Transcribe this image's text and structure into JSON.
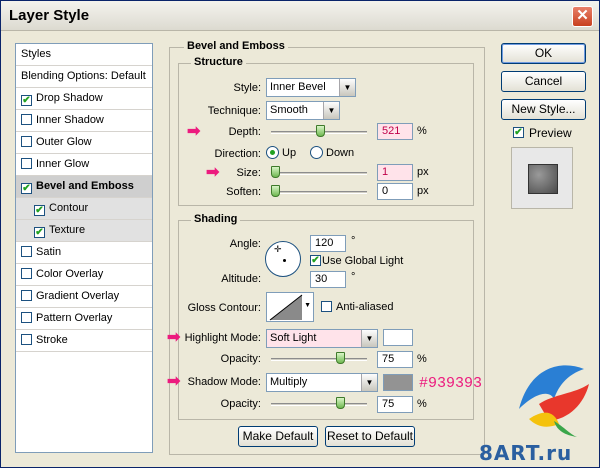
{
  "window": {
    "title": "Layer Style"
  },
  "styles_list": [
    {
      "label": "Styles",
      "checkbox": false,
      "checked": false,
      "selected": false,
      "sub": false
    },
    {
      "label": "Blending Options: Default",
      "checkbox": false,
      "checked": false,
      "selected": false,
      "sub": false
    },
    {
      "label": "Drop Shadow",
      "checkbox": true,
      "checked": true,
      "selected": false,
      "sub": false
    },
    {
      "label": "Inner Shadow",
      "checkbox": true,
      "checked": false,
      "selected": false,
      "sub": false
    },
    {
      "label": "Outer Glow",
      "checkbox": true,
      "checked": false,
      "selected": false,
      "sub": false
    },
    {
      "label": "Inner Glow",
      "checkbox": true,
      "checked": false,
      "selected": false,
      "sub": false
    },
    {
      "label": "Bevel and Emboss",
      "checkbox": true,
      "checked": true,
      "selected": true,
      "sub": false
    },
    {
      "label": "Contour",
      "checkbox": true,
      "checked": true,
      "selected": false,
      "sub": true
    },
    {
      "label": "Texture",
      "checkbox": true,
      "checked": true,
      "selected": false,
      "sub": true
    },
    {
      "label": "Satin",
      "checkbox": true,
      "checked": false,
      "selected": false,
      "sub": false
    },
    {
      "label": "Color Overlay",
      "checkbox": true,
      "checked": false,
      "selected": false,
      "sub": false
    },
    {
      "label": "Gradient Overlay",
      "checkbox": true,
      "checked": false,
      "selected": false,
      "sub": false
    },
    {
      "label": "Pattern Overlay",
      "checkbox": true,
      "checked": false,
      "selected": false,
      "sub": false
    },
    {
      "label": "Stroke",
      "checkbox": true,
      "checked": false,
      "selected": false,
      "sub": false
    }
  ],
  "bevel": {
    "title": "Bevel and Emboss",
    "structure": {
      "title": "Structure",
      "style_label": "Style:",
      "style_value": "Inner Bevel",
      "technique_label": "Technique:",
      "technique_value": "Smooth",
      "depth_label": "Depth:",
      "depth_value": "521",
      "depth_unit": "%",
      "depth_fraction": 0.52,
      "direction_label": "Direction:",
      "direction_up": "Up",
      "direction_down": "Down",
      "size_label": "Size:",
      "size_value": "1",
      "size_unit": "px",
      "size_fraction": 0.0,
      "soften_label": "Soften:",
      "soften_value": "0",
      "soften_unit": "px",
      "soften_fraction": 0.0
    },
    "shading": {
      "title": "Shading",
      "angle_label": "Angle:",
      "angle_value": "120",
      "angle_unit": "°",
      "global_light_label": "Use Global Light",
      "altitude_label": "Altitude:",
      "altitude_value": "30",
      "altitude_unit": "°",
      "gloss_label": "Gloss Contour:",
      "anti_aliased_label": "Anti-aliased",
      "highlight_label": "Highlight Mode:",
      "highlight_value": "Soft Light",
      "highlight_color": "#ffffff",
      "highlight_opacity_label": "Opacity:",
      "highlight_opacity": "75",
      "highlight_opacity_fraction": 0.75,
      "shadow_label": "Shadow Mode:",
      "shadow_value": "Multiply",
      "shadow_color": "#939393",
      "shadow_opacity_label": "Opacity:",
      "shadow_opacity": "75",
      "shadow_opacity_fraction": 0.75,
      "percent": "%"
    },
    "make_default": "Make Default",
    "reset_default": "Reset to Default"
  },
  "buttons": {
    "ok": "OK",
    "cancel": "Cancel",
    "new_style": "New Style...",
    "preview": "Preview"
  },
  "annotation": {
    "hex": "#939393",
    "marker_color": "#ec1b7e"
  },
  "watermark": {
    "text": "8ART.ru"
  },
  "colors": {
    "accent_check": "#21a121",
    "pink_field": "#ffe3ea"
  }
}
